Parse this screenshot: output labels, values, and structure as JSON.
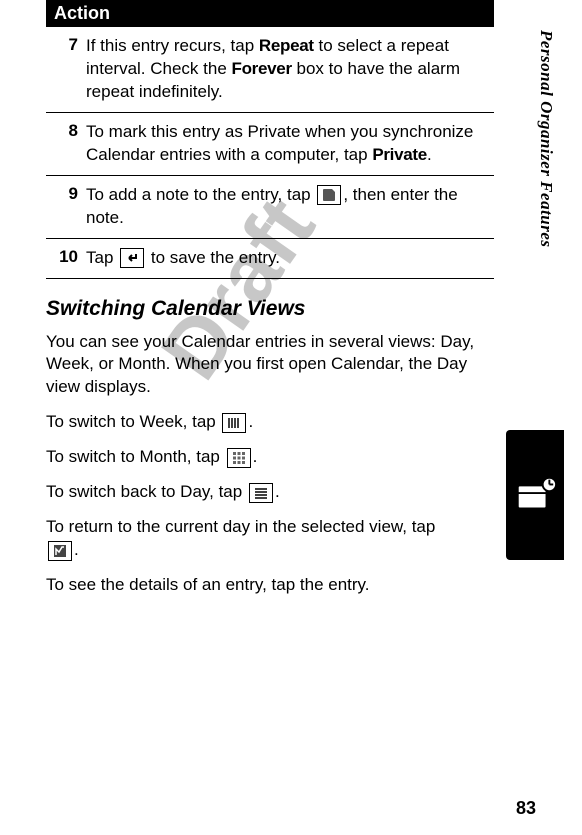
{
  "sideLabel": "Personal Organizer Features",
  "tableHeader": "Action",
  "steps": [
    {
      "num": "7",
      "pre": "If this entry recurs, tap ",
      "label1": "Repeat",
      "mid": " to select a repeat interval. Check the ",
      "label2": "Forever",
      "post": " box to have the alarm repeat indefinitely."
    },
    {
      "num": "8",
      "pre": "To mark this entry as Private when you synchronize Calendar entries with a computer, tap ",
      "label1": "Private",
      "post": "."
    },
    {
      "num": "9",
      "pre": "To add a note to the entry, tap ",
      "icon": "note-icon",
      "post": ", then enter the note."
    },
    {
      "num": "10",
      "pre": "Tap ",
      "icon": "return-arrow-icon",
      "post": " to save the entry."
    }
  ],
  "heading": "Switching Calendar Views",
  "paragraphs": {
    "intro": "You can see your Calendar entries in several views: Day, Week, or Month. When you first open Calendar, the Day view displays.",
    "week_pre": "To switch to Week, tap ",
    "week_post": ".",
    "month_pre": "To switch to Month, tap ",
    "month_post": ".",
    "day_pre": "To switch back to Day, tap ",
    "day_post": ".",
    "return_pre": "To return to the current day in the selected view, tap ",
    "return_post": ".",
    "details": "To see the details of an entry, tap the entry."
  },
  "watermark": "Draft",
  "pageNumber": "83"
}
